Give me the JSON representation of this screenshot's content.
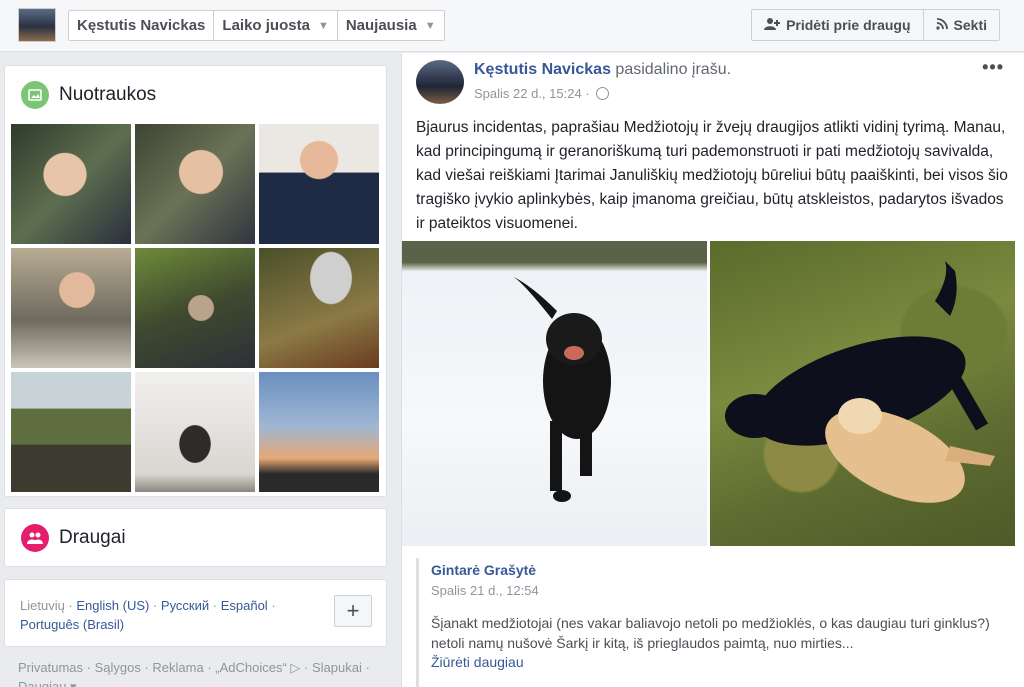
{
  "breadcrumb": {
    "profile_name": "Kęstutis Navickas",
    "timeline_label": "Laiko juosta",
    "sort_label": "Naujausia"
  },
  "actions": {
    "add_friend": "Pridėti prie draugų",
    "follow": "Sekti"
  },
  "photos": {
    "title": "Nuotraukos",
    "accent": "#7cc576"
  },
  "friends": {
    "title": "Draugai",
    "accent": "#e41e6d"
  },
  "languages": {
    "items": [
      "Lietuvių",
      "English (US)",
      "Русский",
      "Español",
      "Português (Brasil)"
    ],
    "more": "+"
  },
  "footer": {
    "links": [
      "Privatumas",
      "Sąlygos",
      "Reklama",
      "„AdChoices“",
      "Slapukai",
      "Daugiau"
    ]
  },
  "post": {
    "author": "Kęstutis Navickas",
    "action": "pasidalino įrašu.",
    "date": "Spalis 22 d., 15:24 ·",
    "menu": "•••",
    "text": "Bjaurus incidentas, paprašiau Medžiotojų ir žvejų draugijos atlikti vidinį tyrimą. Manau, kad principingumą ir geranoriškumą turi pademonstruoti ir pati medžiotojų savivalda, kad viešai reiškiami Įtarimai Januliškių medžiotojų būreliui būtų paaiškinti, bei visos šio tragiško įvykio aplinkybės, kaip įmanoma greičiau, būtų atskleistos, padarytos išvados ir pateiktos visuomenei."
  },
  "shared": {
    "author": "Gintarė Grašytė",
    "date": "Spalis 21 d., 12:54",
    "text": "Šįanakt medžiotojai (nes vakar baliavojo netoli po medžioklės, o kas daugiau turi ginklus?) netoli namų nušovė Šarkį ir kitą, iš prieglaudos paimtą, nuo mirties...",
    "more": "Žiūrėti daugiau"
  }
}
